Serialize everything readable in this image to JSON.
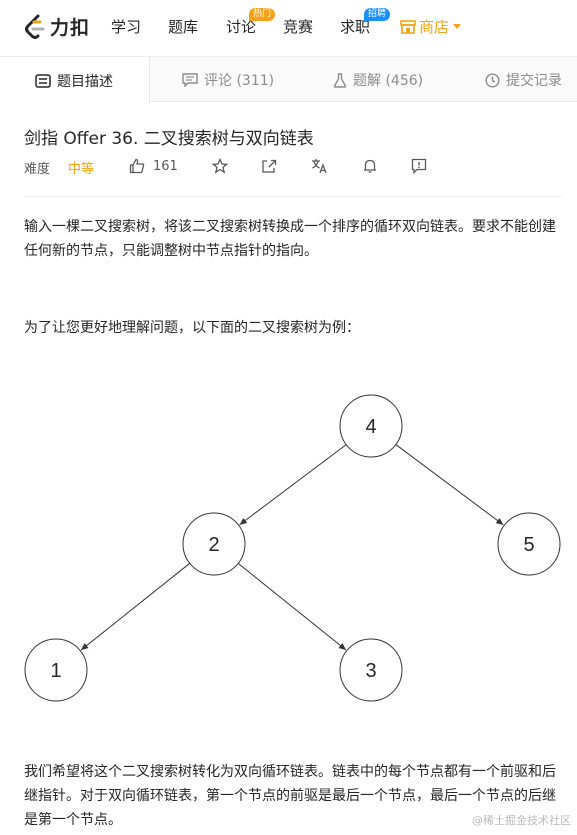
{
  "brand": {
    "name": "力扣"
  },
  "nav": {
    "items": [
      {
        "label": "学习"
      },
      {
        "label": "题库"
      },
      {
        "label": "讨论",
        "badge": "热门"
      },
      {
        "label": "竞赛"
      },
      {
        "label": "求职",
        "badge": "招聘"
      }
    ],
    "shop": "商店"
  },
  "tabs": [
    {
      "label": "题目描述",
      "icon": "description-icon",
      "active": true
    },
    {
      "label": "评论 (311)",
      "icon": "comment-icon",
      "active": false
    },
    {
      "label": "题解 (456)",
      "icon": "flask-icon",
      "active": false
    },
    {
      "label": "提交记录",
      "icon": "clock-icon",
      "active": false
    }
  ],
  "problem": {
    "title": "剑指 Offer 36. 二叉搜索树与双向链表",
    "difficulty_label": "难度",
    "difficulty": "中等",
    "likes": "161",
    "paragraphs": [
      "输入一棵二叉搜索树，将该二叉搜索树转换成一个排序的循环双向链表。要求不能创建任何新的节点，只能调整树中节点指针的指向。",
      "为了让您更好地理解问题，以下面的二叉搜索树为例：",
      "我们希望将这个二叉搜索树转化为双向循环链表。链表中的每个节点都有一个前驱和后继指针。对于双向循环链表，第一个节点的前驱是最后一个节点，最后一个节点的后继是第一个节点。"
    ]
  },
  "tree": {
    "nodes": [
      {
        "id": "4",
        "label": "4"
      },
      {
        "id": "2",
        "label": "2"
      },
      {
        "id": "5",
        "label": "5"
      },
      {
        "id": "1",
        "label": "1"
      },
      {
        "id": "3",
        "label": "3"
      }
    ],
    "edges": [
      [
        "4",
        "2"
      ],
      [
        "4",
        "5"
      ],
      [
        "2",
        "1"
      ],
      [
        "2",
        "3"
      ]
    ]
  },
  "watermark": "@稀土掘金技术社区",
  "colors": {
    "accent": "#f6a21d",
    "hire": "#1a90ff",
    "muted": "#8c8c8c"
  }
}
